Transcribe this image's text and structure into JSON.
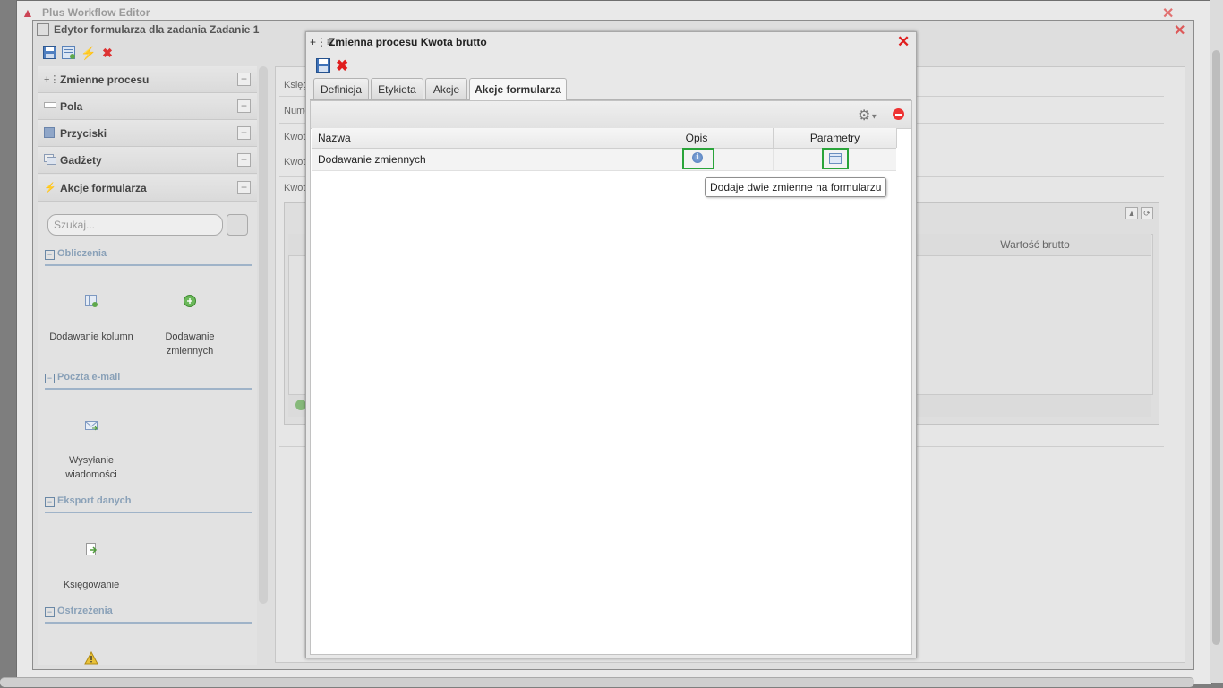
{
  "app": {
    "title": "Plus Workflow Editor"
  },
  "editor": {
    "title": "Edytor formularza dla zadania Zadanie 1",
    "sidebar": {
      "sections": [
        {
          "label": "Zmienne procesu",
          "toggle": "+"
        },
        {
          "label": "Pola",
          "toggle": "+"
        },
        {
          "label": "Przyciski",
          "toggle": "+"
        },
        {
          "label": "Gadżety",
          "toggle": "+"
        },
        {
          "label": "Akcje formularza",
          "toggle": "−"
        }
      ],
      "search_placeholder": "Szukaj...",
      "categories": [
        {
          "label": "Obliczenia",
          "items": [
            "Dodawanie kolumn",
            "Dodawanie zmiennych"
          ]
        },
        {
          "label": "Poczta e-mail",
          "items": [
            "Wysyłanie wiadomości"
          ]
        },
        {
          "label": "Eksport danych",
          "items": [
            "Księgowanie"
          ]
        },
        {
          "label": "Ostrzeżenia",
          "items": []
        }
      ]
    },
    "main": {
      "row_labels": [
        "Księg",
        "Numer",
        "Kwot",
        "Kwot",
        "Kwot"
      ],
      "grid_column": "Wartość brutto"
    }
  },
  "dialog": {
    "title": "Zmienna procesu Kwota brutto",
    "tabs": [
      "Definicja",
      "Etykieta",
      "Akcje",
      "Akcje formularza"
    ],
    "active_tab": "Akcje formularza",
    "table": {
      "columns": [
        "Nazwa",
        "Opis",
        "Parametry"
      ],
      "rows": [
        {
          "name": "Dodawanie zmiennych"
        }
      ]
    },
    "tooltip": "Dodaje dwie zmienne na formularzu"
  },
  "colors": {
    "highlight": "#2aa43a",
    "close": "#e01e1e",
    "category": "#8aa1b8"
  }
}
